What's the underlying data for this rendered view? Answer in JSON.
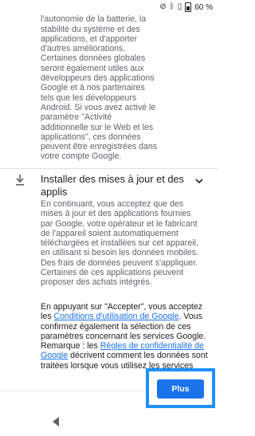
{
  "status_bar": {
    "battery_percent": "60 %",
    "icons": [
      "signal-off-icon",
      "bluetooth-icon",
      "vibrate-icon",
      "battery-icon"
    ]
  },
  "battery": {
    "intro_text": "nous permettront d'optimiser l'autonomie de la batterie, la stabilité du système et des applications, et d'apporter d'autres améliorations. Certaines données globales seront également utiles aux développeurs des applications Google et à nos partenaires tels que les développeurs Android. Si vous avez activé le paramètre \"Activité additionnelle sur le Web et les applications\", ces données peuvent être enregistrées dans votre compte Google."
  },
  "updates_section": {
    "icon": "download-icon",
    "title": "Installer des mises à jour et des applis",
    "body": "En continuant, vous acceptez que des mises à jour et des applications fournies par Google, votre opérateur et le fabricant de l'appareil soient automatiquement téléchargées et installées sur cet appareil, en utilisant si besoin les données mobiles. Des frais de données peuvent s'appliquer. Certaines de ces applications peuvent proposer des achats intégrés.",
    "toggle_icon": "chevron-down-icon"
  },
  "terms": {
    "prefix": "En appuyant sur \"Accepter\", vous acceptez les ",
    "link_terms": "Conditions d'utilisation de Google",
    "middle": ". Vous confirmez également la sélection de ces paramètres concernant les services Google. Remarque : les ",
    "link_privacy": "Règles de confidentialité de Google",
    "suffix": " décrivent comment les données sont traitées lorsque vous utilisez les services"
  },
  "footer": {
    "more_label": "Plus"
  },
  "nav": {
    "back_icon": "back-triangle-icon"
  },
  "colors": {
    "accent": "#1a73e8",
    "highlight_frame": "#1e90ff"
  }
}
